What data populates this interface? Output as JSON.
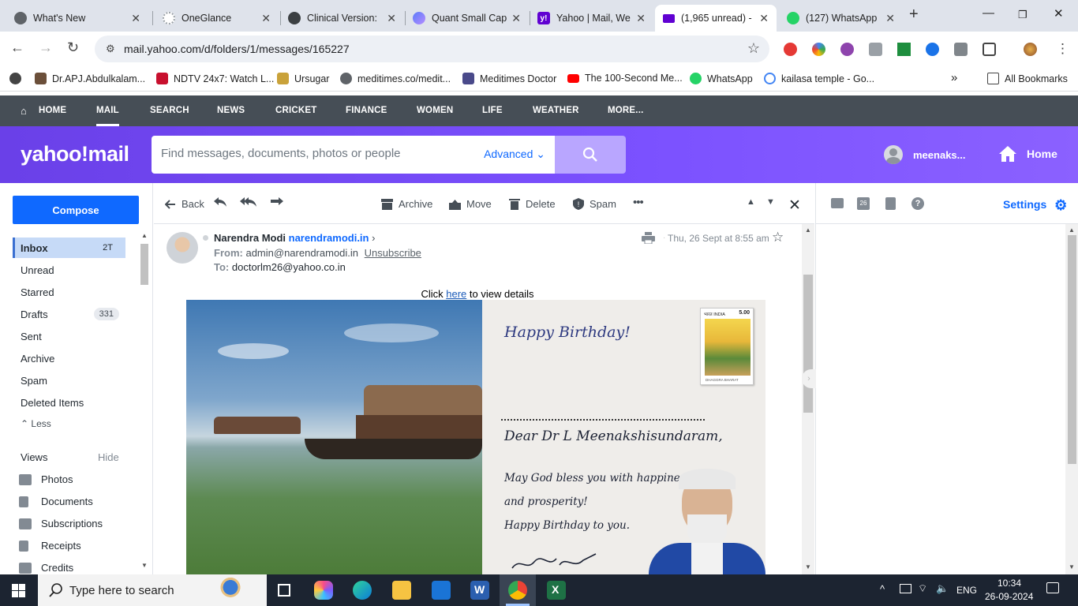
{
  "browser": {
    "tabs": [
      {
        "title": "What's New",
        "icon_color": "#5f6368",
        "active": false
      },
      {
        "title": "OneGlance",
        "icon_color": "#9aa0a6",
        "active": false
      },
      {
        "title": "Clinical Version:",
        "icon_color": "#3c4043",
        "active": false
      },
      {
        "title": "Quant Small Cap",
        "icon_color": "#5b7cfa",
        "active": false
      },
      {
        "title": "Yahoo | Mail, We",
        "icon_color": "#6001d2",
        "active": false
      },
      {
        "title": "(1,965 unread) -",
        "icon_color": "#6001d2",
        "active": true
      },
      {
        "title": "(127) WhatsApp",
        "icon_color": "#25d366",
        "active": false
      }
    ],
    "new_tab_label": "+",
    "url": "mail.yahoo.com/d/folders/1/messages/165227",
    "bookmarks": [
      {
        "label": "Dr.APJ.Abdulkalam...",
        "color": "#6b4f3a"
      },
      {
        "label": "NDTV 24x7: Watch L...",
        "color": "#c8102e"
      },
      {
        "label": "Ursugar",
        "color": "#c9a23a"
      },
      {
        "label": "meditimes.co/medit...",
        "color": "#5f6368"
      },
      {
        "label": "Meditimes Doctor",
        "color": "#4a4a8a"
      },
      {
        "label": "The 100-Second Me...",
        "color": "#ff0000"
      },
      {
        "label": "WhatsApp",
        "color": "#25d366"
      },
      {
        "label": "kailasa temple - Go...",
        "color": "#4285f4"
      }
    ],
    "all_bookmarks_label": "All Bookmarks",
    "overflow_label": "»"
  },
  "ynav": [
    "HOME",
    "MAIL",
    "SEARCH",
    "NEWS",
    "CRICKET",
    "FINANCE",
    "WOMEN",
    "LIFE",
    "WEATHER",
    "MORE..."
  ],
  "header": {
    "logo": "yahoo!mail",
    "search_placeholder": "Find messages, documents, photos or people",
    "advanced_label": "Advanced",
    "username": "meenaks...",
    "home_label": "Home"
  },
  "sidebar": {
    "compose_label": "Compose",
    "folders": [
      {
        "label": "Inbox",
        "count": "2T",
        "active": true
      },
      {
        "label": "Unread"
      },
      {
        "label": "Starred"
      },
      {
        "label": "Drafts",
        "pill": "331"
      },
      {
        "label": "Sent"
      },
      {
        "label": "Archive"
      },
      {
        "label": "Spam"
      },
      {
        "label": "Deleted Items"
      }
    ],
    "less_label": "Less",
    "views_label": "Views",
    "hide_label": "Hide",
    "views": [
      "Photos",
      "Documents",
      "Subscriptions",
      "Receipts",
      "Credits"
    ]
  },
  "toolbar": {
    "back_label": "Back",
    "archive_label": "Archive",
    "move_label": "Move",
    "delete_label": "Delete",
    "spam_label": "Spam",
    "more_label": "•••"
  },
  "message": {
    "sender_name": "Narendra Modi",
    "sender_domain": "narendramodi.in",
    "from_label": "From:",
    "from_address": "admin@narendramodi.in",
    "unsubscribe_label": "Unsubscribe",
    "to_label": "To:",
    "to_address": "doctorlm26@yahoo.co.in",
    "date": "Thu, 26 Sept at 8:55 am",
    "click_prefix": "Click",
    "click_link": "here",
    "click_suffix": "to view details",
    "card": {
      "greeting": "Happy Birthday!",
      "stamp_country": "भारत INDIA",
      "stamp_value": "5.00",
      "stamp_caption": "DHAGGRA BHARAT",
      "dear_line": "Dear Dr L Meenakshisundaram,",
      "line1": "May God bless you with happiness",
      "line2": "and prosperity!",
      "line3": "Happy Birthday to you."
    }
  },
  "rightpane": {
    "settings_label": "Settings",
    "calendar_day": "26",
    "help_label": "?"
  },
  "taskbar": {
    "search_placeholder": "Type here to search",
    "language": "ENG",
    "time": "10:34",
    "date": "26-09-2024"
  },
  "colors": {
    "yahoo_purple": "#6a40e8",
    "link_blue": "#0f69ff",
    "nav_gray": "#464e56"
  }
}
